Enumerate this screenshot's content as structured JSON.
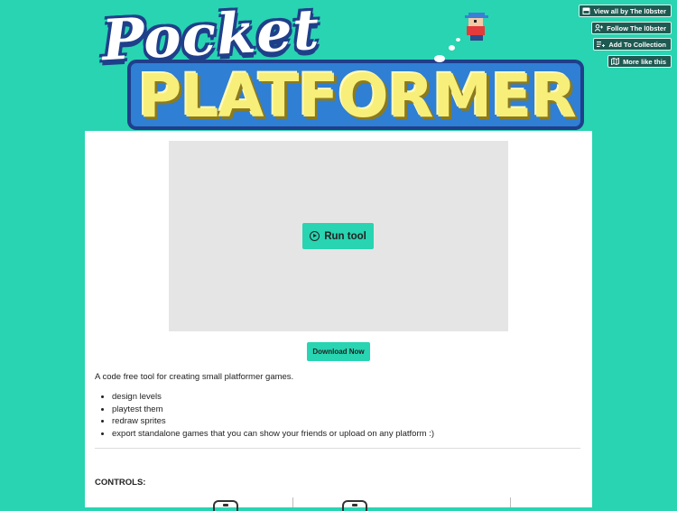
{
  "banner": {
    "title_top": "Pocket",
    "title_bottom": "PLATFORMER"
  },
  "top_buttons": [
    {
      "label": "View all by The l0bster",
      "icon": "itchio-icon"
    },
    {
      "label": "Follow The l0bster",
      "icon": "follow-user-icon"
    },
    {
      "label": "Add To Collection",
      "icon": "add-list-icon"
    },
    {
      "label": "More like this",
      "icon": "map-icon"
    }
  ],
  "game": {
    "run_label": "Run tool"
  },
  "download_label": "Download Now",
  "description": "A code free tool for creating small platformer games.",
  "features": [
    "design levels",
    "playtest them",
    "redraw sprites",
    "export standalone games that you can show your friends or upload on any platform :)"
  ],
  "controls_title": "CONTROLS:",
  "colors": {
    "background": "#28d4b1",
    "accent_button": "#28d4b1",
    "frame": "#e5e5e5"
  }
}
